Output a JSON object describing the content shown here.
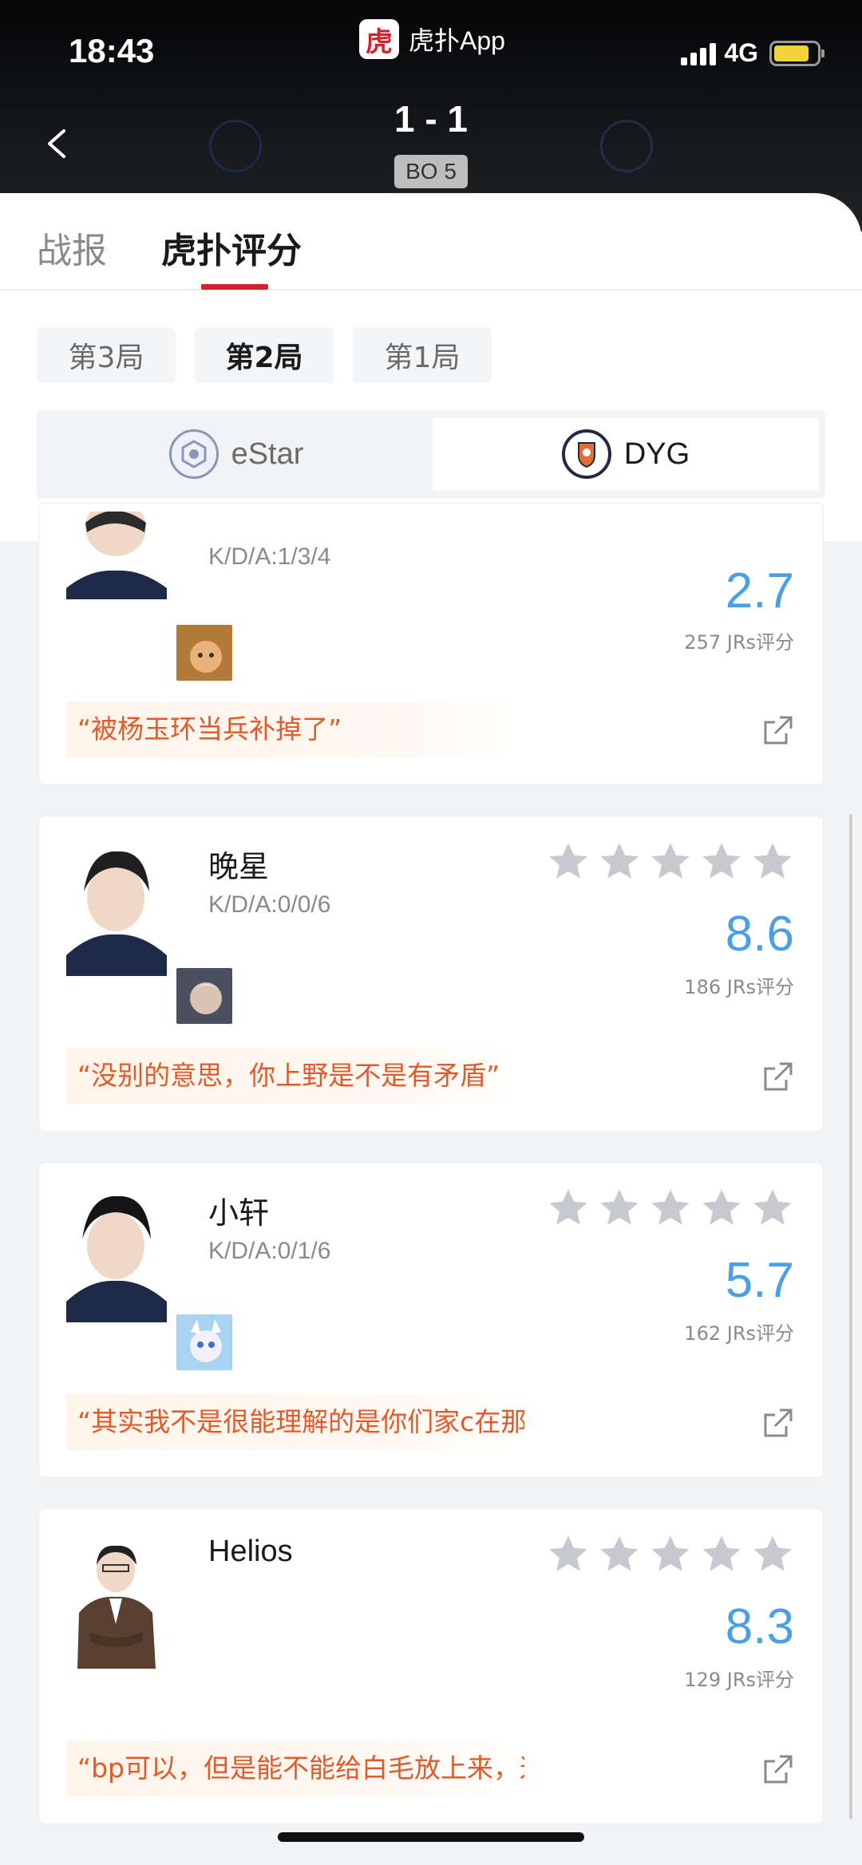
{
  "status_bar": {
    "time": "18:43",
    "app_name": "虎扑App",
    "app_logo_char": "虎",
    "network": "4G",
    "battery_color": "#f3d33a"
  },
  "match": {
    "score": "1 - 1",
    "format": "BO 5",
    "home_team": "eStar",
    "away_team": "DYG"
  },
  "tabs": [
    {
      "label": "战报",
      "active": false
    },
    {
      "label": "虎扑评分",
      "active": true
    }
  ],
  "games": [
    {
      "label": "第3局",
      "active": false
    },
    {
      "label": "第2局",
      "active": true
    },
    {
      "label": "第1局",
      "active": false
    }
  ],
  "team_switch": {
    "left": "eStar",
    "right": "DYG",
    "selected": "DYG"
  },
  "players": [
    {
      "name": "",
      "kda": "K/D/A:1/3/4",
      "rating": "2.7",
      "votes": "257 JRs评分",
      "comment": "“被杨玉环当兵补掉了”"
    },
    {
      "name": "晚星",
      "kda": "K/D/A:0/0/6",
      "rating": "8.6",
      "votes": "186 JRs评分",
      "comment": "“没别的意思，你上野是不是有矛盾”"
    },
    {
      "name": "小轩",
      "kda": "K/D/A:0/1/6",
      "rating": "5.7",
      "votes": "162 JRs评分",
      "comment": "“其实我不是很能理解的是你们家c在那里说了跟不..."
    },
    {
      "name": "Helios",
      "kda": "",
      "rating": "8.3",
      "votes": "129 JRs评分",
      "comment": "“bp可以，但是能不能给白毛放上来，这中单诗人啊”"
    }
  ],
  "icons": {
    "back": "chevron-left-icon",
    "star": "star-icon",
    "share": "share-external-icon"
  },
  "colors": {
    "accent_red": "#d8202a",
    "rating_blue": "#4aa0e6",
    "quote_orange": "#e25a2a",
    "star_gray": "#c8c9ce"
  }
}
